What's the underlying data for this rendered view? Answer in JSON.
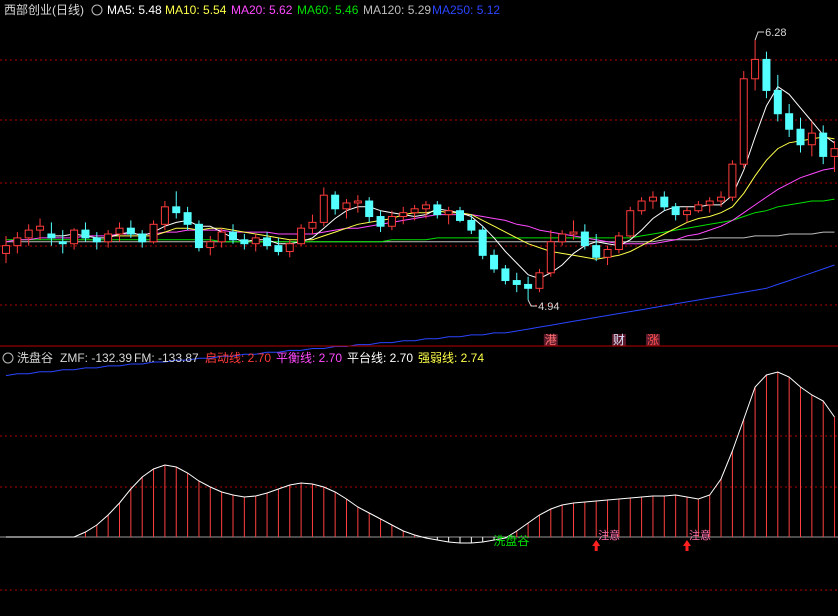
{
  "main_legend": {
    "title": "西部创业(日线)",
    "ma5": "MA5: 5.48",
    "ma10": "MA10: 5.54",
    "ma20": "MA20: 5.62",
    "ma60": "MA60: 5.46",
    "ma120": "MA120: 5.29",
    "ma250": "MA250: 5.12"
  },
  "sub_legend": {
    "title": "洗盘谷",
    "zmf": "ZMF: -132.39",
    "fm": "FM: -133.87",
    "qidong": "启动线: 2.70",
    "pingheng": "平衡线: 2.70",
    "pingtai": "平台线: 2.70",
    "qiangruo": "强弱线: 2.74"
  },
  "colors": {
    "up": "#ff3b3b",
    "down": "#54ffff",
    "ma5": "#ffffff",
    "ma10": "#ffff4a",
    "ma20": "#ff4aff",
    "ma60": "#00e000",
    "ma120": "#bdbdbd",
    "ma250": "#2a45ff",
    "grid": "#b40000",
    "indicator_bar": "#ff4040",
    "indicator_curve": "#ffffff"
  },
  "chart_data": [
    {
      "type": "candlestick",
      "title": "西部创业(日线)",
      "ylim": [
        4.6,
        6.4
      ],
      "ohlc": [
        [
          5.18,
          5.27,
          5.13,
          5.22
        ],
        [
          5.22,
          5.29,
          5.18,
          5.26
        ],
        [
          5.26,
          5.33,
          5.22,
          5.3
        ],
        [
          5.3,
          5.36,
          5.25,
          5.32
        ],
        [
          5.28,
          5.34,
          5.22,
          5.26
        ],
        [
          5.24,
          5.3,
          5.18,
          5.23
        ],
        [
          5.23,
          5.31,
          5.2,
          5.3
        ],
        [
          5.3,
          5.34,
          5.24,
          5.26
        ],
        [
          5.26,
          5.29,
          5.2,
          5.24
        ],
        [
          5.24,
          5.3,
          5.21,
          5.28
        ],
        [
          5.28,
          5.34,
          5.24,
          5.31
        ],
        [
          5.31,
          5.35,
          5.26,
          5.28
        ],
        [
          5.28,
          5.3,
          5.21,
          5.24
        ],
        [
          5.24,
          5.35,
          5.23,
          5.33
        ],
        [
          5.33,
          5.45,
          5.3,
          5.42
        ],
        [
          5.42,
          5.5,
          5.36,
          5.39
        ],
        [
          5.39,
          5.42,
          5.3,
          5.33
        ],
        [
          5.33,
          5.35,
          5.19,
          5.21
        ],
        [
          5.21,
          5.27,
          5.17,
          5.24
        ],
        [
          5.24,
          5.31,
          5.21,
          5.29
        ],
        [
          5.29,
          5.33,
          5.23,
          5.25
        ],
        [
          5.25,
          5.28,
          5.2,
          5.23
        ],
        [
          5.23,
          5.28,
          5.19,
          5.26
        ],
        [
          5.26,
          5.29,
          5.2,
          5.22
        ],
        [
          5.22,
          5.26,
          5.17,
          5.19
        ],
        [
          5.19,
          5.25,
          5.16,
          5.23
        ],
        [
          5.23,
          5.33,
          5.22,
          5.31
        ],
        [
          5.31,
          5.38,
          5.28,
          5.34
        ],
        [
          5.34,
          5.52,
          5.32,
          5.48
        ],
        [
          5.48,
          5.5,
          5.38,
          5.41
        ],
        [
          5.41,
          5.46,
          5.36,
          5.44
        ],
        [
          5.44,
          5.48,
          5.39,
          5.45
        ],
        [
          5.45,
          5.47,
          5.34,
          5.37
        ],
        [
          5.37,
          5.4,
          5.29,
          5.32
        ],
        [
          5.32,
          5.4,
          5.3,
          5.37
        ],
        [
          5.37,
          5.42,
          5.33,
          5.39
        ],
        [
          5.39,
          5.43,
          5.35,
          5.41
        ],
        [
          5.41,
          5.45,
          5.36,
          5.43
        ],
        [
          5.43,
          5.45,
          5.36,
          5.38
        ],
        [
          5.38,
          5.42,
          5.33,
          5.4
        ],
        [
          5.4,
          5.42,
          5.34,
          5.35
        ],
        [
          5.35,
          5.38,
          5.28,
          5.3
        ],
        [
          5.3,
          5.32,
          5.15,
          5.17
        ],
        [
          5.17,
          5.2,
          5.08,
          5.1
        ],
        [
          5.1,
          5.12,
          5.02,
          5.04
        ],
        [
          5.04,
          5.08,
          4.98,
          5.02
        ],
        [
          5.02,
          5.06,
          4.94,
          5.0
        ],
        [
          5.0,
          5.1,
          4.98,
          5.08
        ],
        [
          5.08,
          5.3,
          5.06,
          5.24
        ],
        [
          5.24,
          5.3,
          5.22,
          5.28
        ],
        [
          5.28,
          5.35,
          5.25,
          5.29
        ],
        [
          5.29,
          5.33,
          5.2,
          5.22
        ],
        [
          5.22,
          5.28,
          5.14,
          5.16
        ],
        [
          5.16,
          5.22,
          5.12,
          5.2
        ],
        [
          5.2,
          5.29,
          5.18,
          5.27
        ],
        [
          5.27,
          5.42,
          5.26,
          5.4
        ],
        [
          5.4,
          5.47,
          5.38,
          5.45
        ],
        [
          5.45,
          5.5,
          5.41,
          5.47
        ],
        [
          5.47,
          5.5,
          5.4,
          5.42
        ],
        [
          5.42,
          5.44,
          5.35,
          5.38
        ],
        [
          5.38,
          5.42,
          5.34,
          5.4
        ],
        [
          5.4,
          5.45,
          5.39,
          5.43
        ],
        [
          5.43,
          5.47,
          5.39,
          5.45
        ],
        [
          5.45,
          5.5,
          5.42,
          5.47
        ],
        [
          5.47,
          5.66,
          5.45,
          5.64
        ],
        [
          5.64,
          6.12,
          5.62,
          6.08
        ],
        [
          6.08,
          6.28,
          6.02,
          6.18
        ],
        [
          6.18,
          6.22,
          5.98,
          6.02
        ],
        [
          6.02,
          6.1,
          5.86,
          5.9
        ],
        [
          5.9,
          5.95,
          5.78,
          5.82
        ],
        [
          5.82,
          5.88,
          5.7,
          5.74
        ],
        [
          5.74,
          5.86,
          5.68,
          5.8
        ],
        [
          5.8,
          5.84,
          5.64,
          5.68
        ],
        [
          5.68,
          5.76,
          5.6,
          5.72
        ]
      ],
      "ma5": [
        null,
        null,
        null,
        null,
        5.27,
        5.27,
        5.28,
        5.27,
        5.26,
        5.26,
        5.28,
        5.29,
        5.27,
        5.29,
        5.32,
        5.34,
        5.35,
        5.32,
        5.32,
        5.29,
        5.26,
        5.24,
        5.25,
        5.25,
        5.23,
        5.23,
        5.24,
        5.26,
        5.31,
        5.36,
        5.4,
        5.42,
        5.42,
        5.4,
        5.39,
        5.38,
        5.37,
        5.38,
        5.41,
        5.4,
        5.39,
        5.37,
        5.32,
        5.26,
        5.19,
        5.13,
        5.07,
        5.05,
        5.08,
        5.12,
        5.18,
        5.22,
        5.24,
        5.23,
        5.22,
        5.25,
        5.3,
        5.36,
        5.4,
        5.42,
        5.42,
        5.42,
        5.43,
        5.43,
        5.48,
        5.61,
        5.78,
        5.94,
        6.04,
        6.0,
        5.93,
        5.86,
        5.79,
        5.75
      ],
      "ma10": [
        null,
        null,
        null,
        null,
        null,
        null,
        null,
        null,
        null,
        5.27,
        5.27,
        5.27,
        5.27,
        5.27,
        5.29,
        5.31,
        5.31,
        5.3,
        5.31,
        5.31,
        5.3,
        5.29,
        5.28,
        5.27,
        5.26,
        5.25,
        5.25,
        5.25,
        5.27,
        5.29,
        5.31,
        5.33,
        5.34,
        5.35,
        5.36,
        5.38,
        5.39,
        5.39,
        5.4,
        5.39,
        5.39,
        5.38,
        5.35,
        5.32,
        5.29,
        5.26,
        5.23,
        5.21,
        5.19,
        5.18,
        5.17,
        5.16,
        5.15,
        5.16,
        5.17,
        5.19,
        5.22,
        5.25,
        5.28,
        5.31,
        5.34,
        5.36,
        5.37,
        5.39,
        5.42,
        5.49,
        5.58,
        5.66,
        5.72,
        5.75,
        5.76,
        5.77,
        5.78,
        5.77
      ],
      "ma20": [
        5.24,
        5.25,
        5.25,
        5.26,
        5.26,
        5.26,
        5.26,
        5.27,
        5.27,
        5.27,
        5.28,
        5.28,
        5.28,
        5.28,
        5.29,
        5.29,
        5.3,
        5.3,
        5.3,
        5.3,
        5.29,
        5.29,
        5.29,
        5.29,
        5.28,
        5.28,
        5.28,
        5.28,
        5.29,
        5.3,
        5.31,
        5.31,
        5.32,
        5.33,
        5.34,
        5.35,
        5.36,
        5.37,
        5.38,
        5.38,
        5.38,
        5.38,
        5.37,
        5.36,
        5.35,
        5.33,
        5.32,
        5.3,
        5.29,
        5.28,
        5.27,
        5.26,
        5.25,
        5.24,
        5.23,
        5.23,
        5.23,
        5.23,
        5.24,
        5.25,
        5.27,
        5.28,
        5.3,
        5.32,
        5.35,
        5.39,
        5.43,
        5.47,
        5.51,
        5.54,
        5.57,
        5.59,
        5.61,
        5.62
      ],
      "ma60": [
        5.25,
        5.25,
        5.25,
        5.25,
        5.25,
        5.25,
        5.25,
        5.25,
        5.25,
        5.25,
        5.25,
        5.25,
        5.25,
        5.25,
        5.25,
        5.25,
        5.25,
        5.25,
        5.25,
        5.24,
        5.24,
        5.24,
        5.24,
        5.24,
        5.24,
        5.24,
        5.24,
        5.24,
        5.24,
        5.24,
        5.24,
        5.24,
        5.24,
        5.24,
        5.25,
        5.25,
        5.25,
        5.25,
        5.26,
        5.26,
        5.26,
        5.26,
        5.26,
        5.26,
        5.26,
        5.26,
        5.26,
        5.26,
        5.26,
        5.26,
        5.26,
        5.26,
        5.26,
        5.26,
        5.26,
        5.26,
        5.27,
        5.28,
        5.29,
        5.3,
        5.31,
        5.32,
        5.33,
        5.34,
        5.35,
        5.37,
        5.39,
        5.4,
        5.42,
        5.43,
        5.44,
        5.45,
        5.45,
        5.46
      ],
      "ma120": [
        5.24,
        5.24,
        5.24,
        5.24,
        5.24,
        5.24,
        5.24,
        5.24,
        5.24,
        5.24,
        5.24,
        5.24,
        5.24,
        5.24,
        5.24,
        5.24,
        5.24,
        5.24,
        5.24,
        5.24,
        5.24,
        5.24,
        5.24,
        5.24,
        5.24,
        5.24,
        5.24,
        5.24,
        5.24,
        5.24,
        5.24,
        5.24,
        5.24,
        5.24,
        5.24,
        5.24,
        5.24,
        5.24,
        5.24,
        5.24,
        5.24,
        5.24,
        5.24,
        5.24,
        5.24,
        5.24,
        5.24,
        5.24,
        5.24,
        5.24,
        5.24,
        5.24,
        5.24,
        5.24,
        5.24,
        5.24,
        5.24,
        5.24,
        5.25,
        5.25,
        5.25,
        5.25,
        5.26,
        5.26,
        5.26,
        5.26,
        5.27,
        5.27,
        5.27,
        5.28,
        5.28,
        5.28,
        5.29,
        5.29
      ],
      "ma250": [
        4.55,
        4.56,
        4.56,
        4.57,
        4.57,
        4.58,
        4.58,
        4.59,
        4.59,
        4.6,
        4.6,
        4.61,
        4.61,
        4.62,
        4.62,
        4.63,
        4.63,
        4.64,
        4.64,
        4.65,
        4.65,
        4.66,
        4.66,
        4.67,
        4.67,
        4.68,
        4.68,
        4.69,
        4.69,
        4.7,
        4.7,
        4.71,
        4.71,
        4.72,
        4.72,
        4.73,
        4.73,
        4.74,
        4.74,
        4.75,
        4.75,
        4.76,
        4.76,
        4.77,
        4.77,
        4.78,
        4.79,
        4.8,
        4.81,
        4.82,
        4.83,
        4.84,
        4.85,
        4.86,
        4.87,
        4.88,
        4.89,
        4.9,
        4.91,
        4.92,
        4.93,
        4.94,
        4.95,
        4.96,
        4.97,
        4.98,
        4.99,
        5.0,
        5.02,
        5.04,
        5.06,
        5.08,
        5.1,
        5.12
      ],
      "extremes": [
        {
          "label": "6.28",
          "index": 66,
          "price": 6.28
        },
        {
          "label": "4.94",
          "index": 46,
          "price": 4.94
        }
      ],
      "events": [
        {
          "label": "港",
          "index": 48,
          "color": "#ff7070"
        },
        {
          "label": "财",
          "index": 54,
          "color": "#dde4ff"
        },
        {
          "label": "涨",
          "index": 57,
          "color": "#ff5050"
        }
      ]
    },
    {
      "type": "bar",
      "title": "洗盘谷",
      "values": [
        0,
        0,
        0,
        0,
        0,
        0,
        0,
        5,
        12,
        22,
        34,
        48,
        60,
        68,
        72,
        70,
        64,
        56,
        50,
        45,
        42,
        40,
        41,
        44,
        48,
        52,
        54,
        53,
        50,
        45,
        38,
        30,
        24,
        18,
        12,
        6,
        2,
        -1,
        -3,
        -5,
        -6,
        -6,
        -5,
        -3,
        -1,
        6,
        14,
        22,
        28,
        32,
        34,
        35,
        36,
        37,
        38,
        39,
        40,
        41,
        41,
        42,
        40,
        38,
        42,
        58,
        86,
        118,
        150,
        162,
        165,
        160,
        150,
        142,
        136,
        120
      ],
      "labels": [
        {
          "label": "洗盘谷",
          "index": 44,
          "color": "#00e000"
        },
        {
          "label": "注意",
          "index": 52,
          "color": "#ff70b0",
          "arrow": true
        },
        {
          "label": "注意",
          "index": 60,
          "color": "#ff70b0",
          "arrow": true
        }
      ]
    }
  ]
}
